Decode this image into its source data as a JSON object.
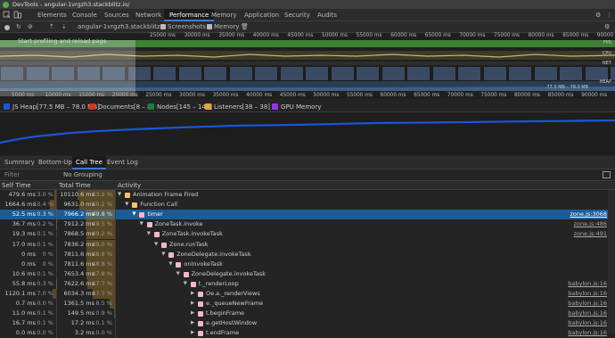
{
  "window": {
    "title": "DevTools - angular-1vrgzh3.stackblitz.io/"
  },
  "tabs": [
    {
      "label": "Elements",
      "active": false
    },
    {
      "label": "Console",
      "active": false
    },
    {
      "label": "Sources",
      "active": false
    },
    {
      "label": "Network",
      "active": false
    },
    {
      "label": "Performance",
      "active": true
    },
    {
      "label": "Memory",
      "active": false
    },
    {
      "label": "Application",
      "active": false
    },
    {
      "label": "Security",
      "active": false
    },
    {
      "label": "Audits",
      "active": false
    }
  ],
  "toolbar": {
    "profile_select": "angular-1vrgzh3.stackblitz...",
    "screenshots_label": "Screenshots",
    "screenshots_checked": true,
    "memory_label": "Memory",
    "memory_checked": true
  },
  "overview": {
    "overlay_message": "Start profiling and reload page",
    "top_ticks": [
      "25000 ms",
      "30000 ms",
      "35000 ms",
      "40000 ms",
      "45000 ms",
      "50000 ms",
      "55000 ms",
      "60000 ms",
      "65000 ms",
      "70000 ms",
      "75000 ms",
      "80000 ms",
      "85000 ms",
      "90000 ms"
    ],
    "bottom_ticks": [
      "5000 ms",
      "10000 ms",
      "15000 ms",
      "20000 ms",
      "25000 ms",
      "30000 ms",
      "35000 ms",
      "40000 ms",
      "45000 ms",
      "50000 ms",
      "55000 ms",
      "60000 ms",
      "65000 ms",
      "70000 ms",
      "75000 ms",
      "80000 ms",
      "85000 ms",
      "90000 ms"
    ],
    "track_labels": {
      "fps": "FPS",
      "cpu": "CPU",
      "net": "NET",
      "heap": "HEAP"
    },
    "heap_range": "77.5 MB – 78.0 MB"
  },
  "memory_legend": [
    {
      "label": "JS Heap[77.5 MB – 78.0 MB]",
      "color": "#1a56d6",
      "checked": true
    },
    {
      "label": "Documents[8 – 8]",
      "color": "#d93025",
      "checked": true
    },
    {
      "label": "Nodes[145 – 145]",
      "color": "#188038",
      "checked": true
    },
    {
      "label": "Listeners[38 – 38]",
      "color": "#e8a33d",
      "checked": true
    },
    {
      "label": "GPU Memory",
      "color": "#9334e6",
      "checked": true
    }
  ],
  "lower_tabs": [
    {
      "label": "Summary",
      "active": false
    },
    {
      "label": "Bottom-Up",
      "active": false
    },
    {
      "label": "Call Tree",
      "active": true
    },
    {
      "label": "Event Log",
      "active": false
    }
  ],
  "filter": {
    "placeholder": "Filter",
    "grouping": "No Grouping"
  },
  "columns": {
    "self": "Self Time",
    "total": "Total Time",
    "activity": "Activity"
  },
  "rows": [
    {
      "self_ms": "479.6 ms",
      "self_pct": "3.0 %",
      "total_ms": "10110.6 ms",
      "total_pct": "63.2 %",
      "total_frac": 0.632,
      "self_frac": 0.03,
      "depth": 0,
      "expanded": true,
      "name": "Animation Frame Fired",
      "color": "#f2c36b",
      "source": "",
      "selected": false
    },
    {
      "self_ms": "1664.6 ms",
      "self_pct": "10.4 %",
      "total_ms": "9631.0 ms",
      "total_pct": "60.2 %",
      "total_frac": 0.602,
      "self_frac": 0.104,
      "depth": 1,
      "expanded": true,
      "name": "Function Call",
      "color": "#f2c36b",
      "source": "",
      "selected": false
    },
    {
      "self_ms": "52.5 ms",
      "self_pct": "0.3 %",
      "total_ms": "7966.2 ms",
      "total_pct": "49.8 %",
      "total_frac": 0.498,
      "self_frac": 0.003,
      "depth": 2,
      "expanded": true,
      "name": "timer",
      "color": "#f4b6cf",
      "source": "zone.js:3068",
      "selected": true
    },
    {
      "self_ms": "36.7 ms",
      "self_pct": "0.2 %",
      "total_ms": "7912.2 ms",
      "total_pct": "49.5 %",
      "total_frac": 0.495,
      "self_frac": 0.002,
      "depth": 3,
      "expanded": true,
      "name": "ZoneTask.invoke",
      "color": "#f4b6cf",
      "source": "zone.js:486",
      "selected": false
    },
    {
      "self_ms": "19.3 ms",
      "self_pct": "0.1 %",
      "total_ms": "7868.5 ms",
      "total_pct": "49.2 %",
      "total_frac": 0.492,
      "self_frac": 0.001,
      "depth": 4,
      "expanded": true,
      "name": "ZoneTask.invokeTask",
      "color": "#f4b6cf",
      "source": "zone.js:491",
      "selected": false
    },
    {
      "self_ms": "17.0 ms",
      "self_pct": "0.1 %",
      "total_ms": "7836.2 ms",
      "total_pct": "49.0 %",
      "total_frac": 0.49,
      "self_frac": 0.001,
      "depth": 5,
      "expanded": true,
      "name": "Zone.runTask",
      "color": "#f4b6cf",
      "source": "",
      "selected": false
    },
    {
      "self_ms": "0 ms",
      "self_pct": "0 %",
      "total_ms": "7811.6 ms",
      "total_pct": "48.8 %",
      "total_frac": 0.488,
      "self_frac": 0,
      "depth": 6,
      "expanded": true,
      "name": "ZoneDelegate.invokeTask",
      "color": "#f4b6cf",
      "source": "",
      "selected": false
    },
    {
      "self_ms": "0 ms",
      "self_pct": "0 %",
      "total_ms": "7811.6 ms",
      "total_pct": "48.8 %",
      "total_frac": 0.488,
      "self_frac": 0,
      "depth": 7,
      "expanded": true,
      "name": "onInvokeTask",
      "color": "#f4b6cf",
      "source": "",
      "selected": false
    },
    {
      "self_ms": "10.6 ms",
      "self_pct": "0.1 %",
      "total_ms": "7653.4 ms",
      "total_pct": "47.8 %",
      "total_frac": 0.478,
      "self_frac": 0.001,
      "depth": 8,
      "expanded": true,
      "name": "ZoneDelegate.invokeTask",
      "color": "#f4b6cf",
      "source": "",
      "selected": false
    },
    {
      "self_ms": "55.8 ms",
      "self_pct": "0.3 %",
      "total_ms": "7622.6 ms",
      "total_pct": "47.7 %",
      "total_frac": 0.477,
      "self_frac": 0.003,
      "depth": 9,
      "expanded": true,
      "name": "t._renderLoop",
      "color": "#f4b6cf",
      "source": "babylon.js:16",
      "selected": false
    },
    {
      "self_ms": "1120.1 ms",
      "self_pct": "7.0 %",
      "total_ms": "6034.3 ms",
      "total_pct": "37.7 %",
      "total_frac": 0.377,
      "self_frac": 0.07,
      "depth": 10,
      "expanded": false,
      "name": "Oe.a._renderViews",
      "color": "#f4b6cf",
      "source": "babylon.js:16",
      "selected": false
    },
    {
      "self_ms": "0.7 ms",
      "self_pct": "0.0 %",
      "total_ms": "1361.5 ms",
      "total_pct": "8.5 %",
      "total_frac": 0.085,
      "self_frac": 0,
      "depth": 10,
      "expanded": false,
      "name": "e._queueNewFrame",
      "color": "#f4b6cf",
      "source": "babylon.js:16",
      "selected": false
    },
    {
      "self_ms": "11.0 ms",
      "self_pct": "0.1 %",
      "total_ms": "149.5 ms",
      "total_pct": "0.9 %",
      "total_frac": 0.009,
      "self_frac": 0.001,
      "depth": 10,
      "expanded": false,
      "name": "t.beginFrame",
      "color": "#f4b6cf",
      "source": "babylon.js:16",
      "selected": false
    },
    {
      "self_ms": "16.7 ms",
      "self_pct": "0.1 %",
      "total_ms": "17.2 ms",
      "total_pct": "0.1 %",
      "total_frac": 0.001,
      "self_frac": 0.001,
      "depth": 10,
      "expanded": false,
      "name": "e.getHostWindow",
      "color": "#f4b6cf",
      "source": "babylon.js:16",
      "selected": false
    },
    {
      "self_ms": "0.0 ms",
      "self_pct": "0.0 %",
      "total_ms": "3.2 ms",
      "total_pct": "0.0 %",
      "total_frac": 0,
      "self_frac": 0,
      "depth": 10,
      "expanded": false,
      "name": "t.endFrame",
      "color": "#f4b6cf",
      "source": "babylon.js:16",
      "selected": false
    }
  ]
}
